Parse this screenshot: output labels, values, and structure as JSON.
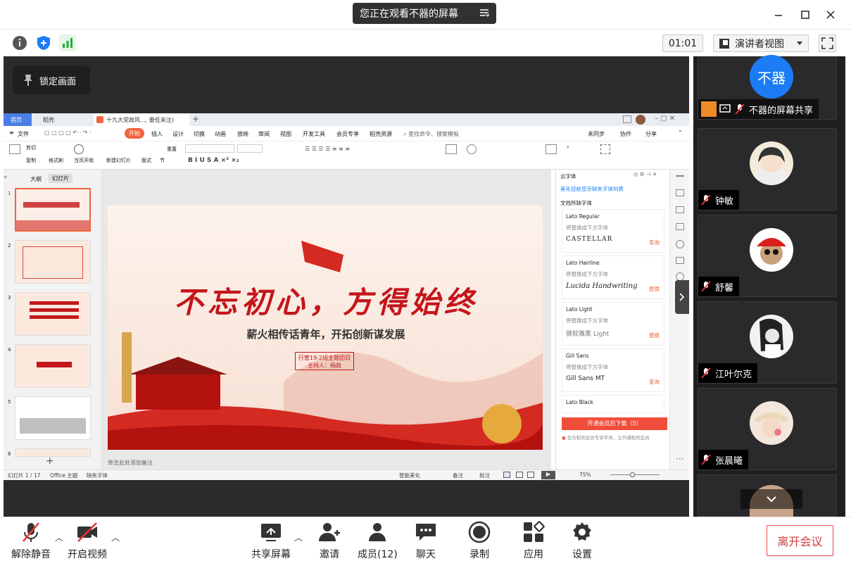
{
  "topbar": {
    "share_banner": "您正在观看不器的屏幕",
    "timer": "01:01",
    "view_mode": "演讲者视图"
  },
  "stage": {
    "lock_label": "锁定画面"
  },
  "ppt": {
    "tabs": [
      "首页",
      "稻壳",
      "十九大党政风..., 委任关注)"
    ],
    "menus": [
      "文件",
      "开始",
      "插入",
      "设计",
      "切换",
      "动画",
      "放映",
      "审阅",
      "视图",
      "开发工具",
      "会员专享",
      "稻壳资源"
    ],
    "search_placeholder": "查找命令、搜索模板",
    "menu_right": [
      "未同步",
      "协作",
      "分享"
    ],
    "ribbon_items": [
      "格式刷",
      "当页开始",
      "新建幻灯片",
      "版式",
      "节",
      "重置",
      "剪切",
      "复制"
    ],
    "thumb_tabs": [
      "大纲",
      "幻灯片"
    ],
    "slide_count_labels": [
      "1",
      "2",
      "3",
      "4",
      "5",
      "6"
    ],
    "slide": {
      "title": "不忘初心，方得始终",
      "subtitle": "薪火相传话青年，开拓创新谋发展",
      "box_line1": "行管19-2班主题团日",
      "box_line2": "主持人：杨政"
    },
    "notes_placeholder": "单击此处添加备注",
    "status": {
      "slide_pos": "幻灯片 1 / 17",
      "theme": "Office 主题",
      "missing_font": "缺失字体",
      "beautify": "智能美化",
      "notes": "备注",
      "comments": "批注",
      "zoom": "75%"
    },
    "font_panel": {
      "title": "云字体",
      "link": "美化目前显示缺失字体列表",
      "section": "文档所缺字体",
      "cards": [
        {
          "name": "Lato Regular",
          "hint": "将替换成下方字体",
          "sample": "CASTELLAR",
          "action": "查询"
        },
        {
          "name": "Lato Hairline",
          "hint": "将替换成下方字体",
          "sample": "Lucida Handwriting",
          "action": "替换"
        },
        {
          "name": "Lato Light",
          "hint": "将替换成下方字体",
          "sample": "微软雅黑 Light",
          "action": "替换"
        },
        {
          "name": "Gill Sans",
          "hint": "将替换成下方字体",
          "sample": "Gill Sans MT",
          "action": "查询"
        },
        {
          "name": "Lato Black",
          "hint": "",
          "sample": "",
          "action": ""
        }
      ],
      "download_btn": "开通会员后下载（5）",
      "footnote": "包含稻壳会员专享字体，立开通稻壳会员"
    }
  },
  "participants": [
    {
      "name": "不器的屏幕共享",
      "avatar_text": "不器"
    },
    {
      "name": "钟敏"
    },
    {
      "name": "舒馨"
    },
    {
      "name": "江叶尔克"
    },
    {
      "name": "张晨曦"
    },
    {
      "name": ""
    }
  ],
  "toolbar": {
    "unmute": "解除静音",
    "video": "开启视频",
    "share": "共享屏幕",
    "invite": "邀请",
    "members": "成员(12)",
    "chat": "聊天",
    "record": "录制",
    "apps": "应用",
    "settings": "设置",
    "leave": "离开会议"
  },
  "colors": {
    "accent_blue": "#1b7cf5",
    "leave_red": "#d23a3a",
    "wps_orange": "#f0653c",
    "slide_red": "#c4161c"
  }
}
